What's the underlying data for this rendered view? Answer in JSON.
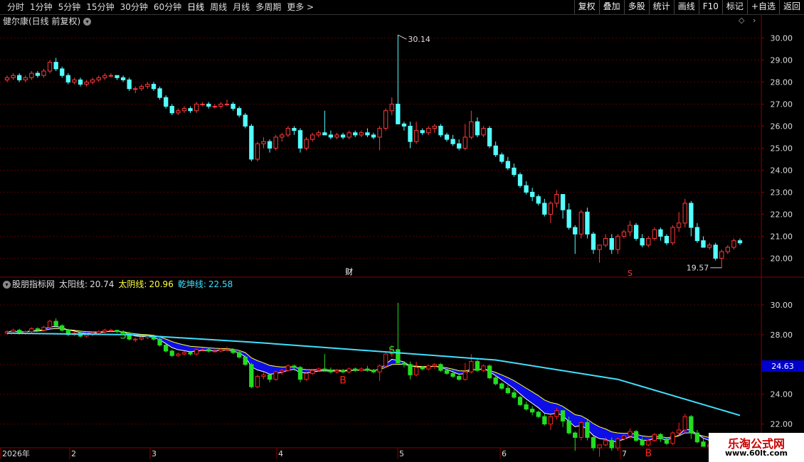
{
  "toolbar": {
    "periods": [
      "分时",
      "1分钟",
      "5分钟",
      "15分钟",
      "30分钟",
      "60分钟",
      "日线",
      "周线",
      "月线",
      "多周期",
      "更多 >"
    ],
    "active_period": "日线",
    "buttons": [
      "复权",
      "叠加",
      "多股",
      "统计",
      "画线",
      "F10",
      "标记",
      "+自选",
      "返回"
    ]
  },
  "main_panel": {
    "title": "健尔康(日线 前复权)",
    "high_label": "30.14",
    "low_label": "19.57",
    "marker_cai": "财",
    "marker_s": "S",
    "y_ticks": [
      "30.00",
      "29.00",
      "28.00",
      "27.00",
      "26.00",
      "25.00",
      "24.00",
      "23.00",
      "22.00",
      "21.00",
      "20.00"
    ]
  },
  "indicator_panel": {
    "name": "股朋指标网",
    "line1_label": "太阳线:",
    "line1_value": "20.74",
    "line2_label": "太阴线:",
    "line2_value": "20.96",
    "line3_label": "乾坤线:",
    "line3_value": "22.58",
    "y_ticks": [
      "30.00",
      "28.00",
      "26.00",
      "24.00",
      "22.00"
    ],
    "current_value": "24.63",
    "signals": [
      "S",
      "B",
      "S",
      "B"
    ]
  },
  "x_axis": {
    "labels": [
      "2026年",
      "2",
      "3",
      "4",
      "5",
      "6",
      "7"
    ]
  },
  "watermark": {
    "site_name": "乐淘公式网",
    "url": "www.60lt.com"
  },
  "colors": {
    "up": "#ff3b3b",
    "down": "#54ffff",
    "ind_up": "#ff2020",
    "ind_down": "#22dd22",
    "band": "#1010ff",
    "qiankun": "#40e0ff",
    "grid": "#5a0000"
  },
  "chart_data": {
    "type": "candlestick",
    "ohlc": [
      [
        28.1,
        28.3,
        28.0,
        28.2
      ],
      [
        28.2,
        28.4,
        28.1,
        28.3
      ],
      [
        28.3,
        28.4,
        28.0,
        28.1
      ],
      [
        28.1,
        28.3,
        28.0,
        28.2
      ],
      [
        28.2,
        28.5,
        28.1,
        28.4
      ],
      [
        28.4,
        28.5,
        28.2,
        28.3
      ],
      [
        28.3,
        28.6,
        28.2,
        28.5
      ],
      [
        28.5,
        29.0,
        28.4,
        28.9
      ],
      [
        28.9,
        29.1,
        28.5,
        28.6
      ],
      [
        28.6,
        28.7,
        28.2,
        28.3
      ],
      [
        28.3,
        28.4,
        27.9,
        28.0
      ],
      [
        28.0,
        28.2,
        27.9,
        28.1
      ],
      [
        28.1,
        28.2,
        27.8,
        27.9
      ],
      [
        27.9,
        28.1,
        27.8,
        28.0
      ],
      [
        28.0,
        28.2,
        27.9,
        28.1
      ],
      [
        28.1,
        28.3,
        28.0,
        28.2
      ],
      [
        28.2,
        28.4,
        28.1,
        28.3
      ],
      [
        28.3,
        28.4,
        28.2,
        28.3
      ],
      [
        28.3,
        28.3,
        28.1,
        28.2
      ],
      [
        28.2,
        28.3,
        28.0,
        28.1
      ],
      [
        28.1,
        28.2,
        27.6,
        27.7
      ],
      [
        27.7,
        27.8,
        27.5,
        27.7
      ],
      [
        27.7,
        27.9,
        27.6,
        27.8
      ],
      [
        27.8,
        28.0,
        27.7,
        27.9
      ],
      [
        27.9,
        28.0,
        27.6,
        27.7
      ],
      [
        27.7,
        27.8,
        27.2,
        27.3
      ],
      [
        27.3,
        27.4,
        26.8,
        26.9
      ],
      [
        26.9,
        27.0,
        26.5,
        26.6
      ],
      [
        26.6,
        26.8,
        26.5,
        26.7
      ],
      [
        26.7,
        26.9,
        26.6,
        26.8
      ],
      [
        26.8,
        26.9,
        26.6,
        26.7
      ],
      [
        26.7,
        27.1,
        26.6,
        27.0
      ],
      [
        27.0,
        27.1,
        26.9,
        27.0
      ],
      [
        27.0,
        27.1,
        26.8,
        26.9
      ],
      [
        26.9,
        27.0,
        26.8,
        26.9
      ],
      [
        26.9,
        27.1,
        26.8,
        27.0
      ],
      [
        27.0,
        27.2,
        26.9,
        27.0
      ],
      [
        27.0,
        27.1,
        26.7,
        26.8
      ],
      [
        26.8,
        26.9,
        26.4,
        26.5
      ],
      [
        26.5,
        26.6,
        25.9,
        26.0
      ],
      [
        26.0,
        26.1,
        24.4,
        24.5
      ],
      [
        24.5,
        25.3,
        24.4,
        25.2
      ],
      [
        25.2,
        25.5,
        25.0,
        25.3
      ],
      [
        25.3,
        25.4,
        24.8,
        25.0
      ],
      [
        25.0,
        25.6,
        24.9,
        25.5
      ],
      [
        25.5,
        25.7,
        25.3,
        25.6
      ],
      [
        25.6,
        26.0,
        25.5,
        25.9
      ],
      [
        25.9,
        26.0,
        25.6,
        25.8
      ],
      [
        25.8,
        25.9,
        24.8,
        25.0
      ],
      [
        25.0,
        25.5,
        24.9,
        25.4
      ],
      [
        25.4,
        25.7,
        25.3,
        25.6
      ],
      [
        25.6,
        25.8,
        25.5,
        25.7
      ],
      [
        25.7,
        26.7,
        25.6,
        25.6
      ],
      [
        25.6,
        25.8,
        25.4,
        25.5
      ],
      [
        25.5,
        25.7,
        25.4,
        25.6
      ],
      [
        25.6,
        25.7,
        25.4,
        25.5
      ],
      [
        25.5,
        25.8,
        25.4,
        25.7
      ],
      [
        25.7,
        25.8,
        25.5,
        25.6
      ],
      [
        25.6,
        25.8,
        25.5,
        25.7
      ],
      [
        25.7,
        25.9,
        25.5,
        25.6
      ],
      [
        25.6,
        25.7,
        25.4,
        25.5
      ],
      [
        25.5,
        26.0,
        24.9,
        25.9
      ],
      [
        25.9,
        26.8,
        25.8,
        26.7
      ],
      [
        26.7,
        27.3,
        26.5,
        27.0
      ],
      [
        27.0,
        30.14,
        26.8,
        26.1
      ],
      [
        26.1,
        26.2,
        25.8,
        26.0
      ],
      [
        26.0,
        26.2,
        25.0,
        25.3
      ],
      [
        25.3,
        26.2,
        25.2,
        25.8
      ],
      [
        25.8,
        25.9,
        25.6,
        25.7
      ],
      [
        25.7,
        26.0,
        25.6,
        25.9
      ],
      [
        25.9,
        26.1,
        25.7,
        26.0
      ],
      [
        26.0,
        26.1,
        25.5,
        25.6
      ],
      [
        25.6,
        25.7,
        25.3,
        25.4
      ],
      [
        25.4,
        25.6,
        25.1,
        25.2
      ],
      [
        25.2,
        25.4,
        24.9,
        25.0
      ],
      [
        25.0,
        26.1,
        24.9,
        25.5
      ],
      [
        25.5,
        26.7,
        25.4,
        26.2
      ],
      [
        26.2,
        26.4,
        25.5,
        25.6
      ],
      [
        25.6,
        26.0,
        25.5,
        25.9
      ],
      [
        25.9,
        26.0,
        25.0,
        25.1
      ],
      [
        25.1,
        25.3,
        24.6,
        24.7
      ],
      [
        24.7,
        24.8,
        24.3,
        24.4
      ],
      [
        24.4,
        24.6,
        24.0,
        24.1
      ],
      [
        24.1,
        24.3,
        23.7,
        23.8
      ],
      [
        23.8,
        23.9,
        23.2,
        23.3
      ],
      [
        23.3,
        23.5,
        22.9,
        23.0
      ],
      [
        23.0,
        23.2,
        22.6,
        22.8
      ],
      [
        22.8,
        22.9,
        22.4,
        22.5
      ],
      [
        22.5,
        22.7,
        21.9,
        22.0
      ],
      [
        22.0,
        22.6,
        21.6,
        22.5
      ],
      [
        22.5,
        23.1,
        22.3,
        22.9
      ],
      [
        22.9,
        22.9,
        21.8,
        22.2
      ],
      [
        22.2,
        22.5,
        21.3,
        21.4
      ],
      [
        21.4,
        21.5,
        20.2,
        21.1
      ],
      [
        21.1,
        22.2,
        20.9,
        22.1
      ],
      [
        22.1,
        22.3,
        20.9,
        21.1
      ],
      [
        21.1,
        21.2,
        20.2,
        20.4
      ],
      [
        20.4,
        20.6,
        19.8,
        20.6
      ],
      [
        20.6,
        21.1,
        20.5,
        20.9
      ],
      [
        20.9,
        21.1,
        20.2,
        20.4
      ],
      [
        20.4,
        21.1,
        20.2,
        21.0
      ],
      [
        21.0,
        21.3,
        20.9,
        21.2
      ],
      [
        21.2,
        21.7,
        21.0,
        21.5
      ],
      [
        21.5,
        21.6,
        20.8,
        20.9
      ],
      [
        20.9,
        21.1,
        20.5,
        20.6
      ],
      [
        20.6,
        21.0,
        20.5,
        20.9
      ],
      [
        20.9,
        21.4,
        20.8,
        21.3
      ],
      [
        21.3,
        21.4,
        20.8,
        21.0
      ],
      [
        21.0,
        21.1,
        20.6,
        20.7
      ],
      [
        20.7,
        21.5,
        20.6,
        21.4
      ],
      [
        21.4,
        22.1,
        21.2,
        21.6
      ],
      [
        21.6,
        22.7,
        21.4,
        22.5
      ],
      [
        22.5,
        22.6,
        21.0,
        21.4
      ],
      [
        21.4,
        21.6,
        20.7,
        20.8
      ],
      [
        20.8,
        21.0,
        20.5,
        20.5
      ],
      [
        20.5,
        20.7,
        20.4,
        20.6
      ],
      [
        20.6,
        20.7,
        19.9,
        20.0
      ],
      [
        20.0,
        20.4,
        19.57,
        20.3
      ],
      [
        20.3,
        20.6,
        20.2,
        20.5
      ],
      [
        20.5,
        20.9,
        20.4,
        20.8
      ],
      [
        20.8,
        20.9,
        20.6,
        20.7
      ]
    ],
    "qiankun_line": {
      "x": [
        0,
        20,
        40,
        60,
        80,
        100,
        120
      ],
      "y": [
        28.1,
        28.0,
        27.5,
        26.9,
        26.3,
        25.0,
        22.58
      ]
    },
    "indicator_ylim": [
      20.5,
      31.0
    ],
    "main_ylim": [
      19.4,
      30.5
    ]
  }
}
